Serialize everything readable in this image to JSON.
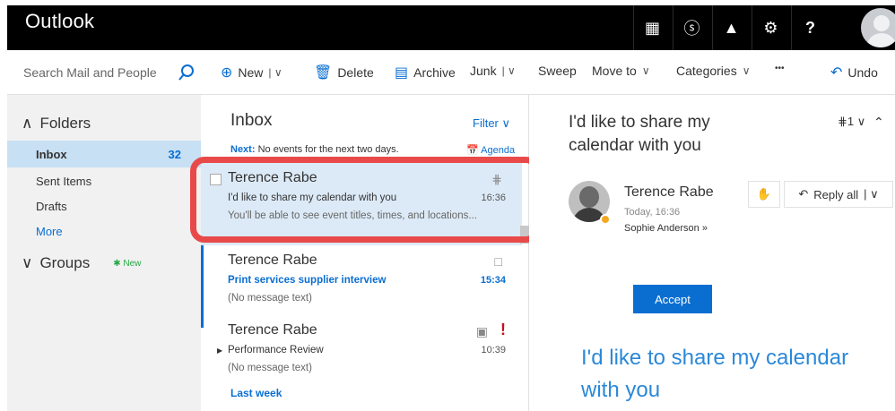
{
  "app": {
    "title": "Outlook"
  },
  "topbar": {
    "icons": [
      "app-launcher-icon",
      "skype-icon",
      "bell-icon",
      "gear-icon",
      "help-icon"
    ],
    "glyphs": [
      "▦",
      "ⓢ",
      "▲",
      "⚙",
      "?"
    ]
  },
  "search": {
    "placeholder": "Search Mail and People"
  },
  "commands": {
    "new": "New",
    "delete": "Delete",
    "archive": "Archive",
    "junk": "Junk",
    "sweep": "Sweep",
    "move_to": "Move to",
    "categories": "Categories",
    "more": "•••",
    "undo": "Undo"
  },
  "sidebar": {
    "folders_label": "Folders",
    "items": [
      {
        "label": "Inbox",
        "count": "32"
      },
      {
        "label": "Sent Items"
      },
      {
        "label": "Drafts"
      },
      {
        "label": "More"
      }
    ],
    "groups_label": "Groups",
    "groups_new": "New"
  },
  "list": {
    "title": "Inbox",
    "filter": "Filter",
    "next_label": "Next:",
    "next_text": "No events for the next two days.",
    "agenda": "Agenda",
    "messages": [
      {
        "from": "Terence Rabe",
        "subject": "I'd like to share my calendar with you",
        "time": "16:36",
        "preview": "You'll be able to see event titles, times, and locations..."
      },
      {
        "from": "Terence Rabe",
        "subject": "Print services supplier interview",
        "time": "15:34",
        "preview": "(No message text)"
      },
      {
        "from": "Terence Rabe",
        "subject": "Performance Review",
        "time": "10:39",
        "preview": "(No message text)",
        "flag": "!"
      }
    ],
    "last_week": "Last week"
  },
  "reading": {
    "title": "I'd like to share my calendar with you",
    "attach_count": "1",
    "sender": "Terence Rabe",
    "date": "Today, 16:36",
    "to": "Sophie Anderson",
    "reply_all": "Reply all",
    "accept": "Accept",
    "body_heading": "I'd like to share my calendar with you"
  },
  "colors": {
    "accent": "#0a6ed1",
    "highlight": "#e84a4a",
    "selected": "#dceaf7"
  }
}
